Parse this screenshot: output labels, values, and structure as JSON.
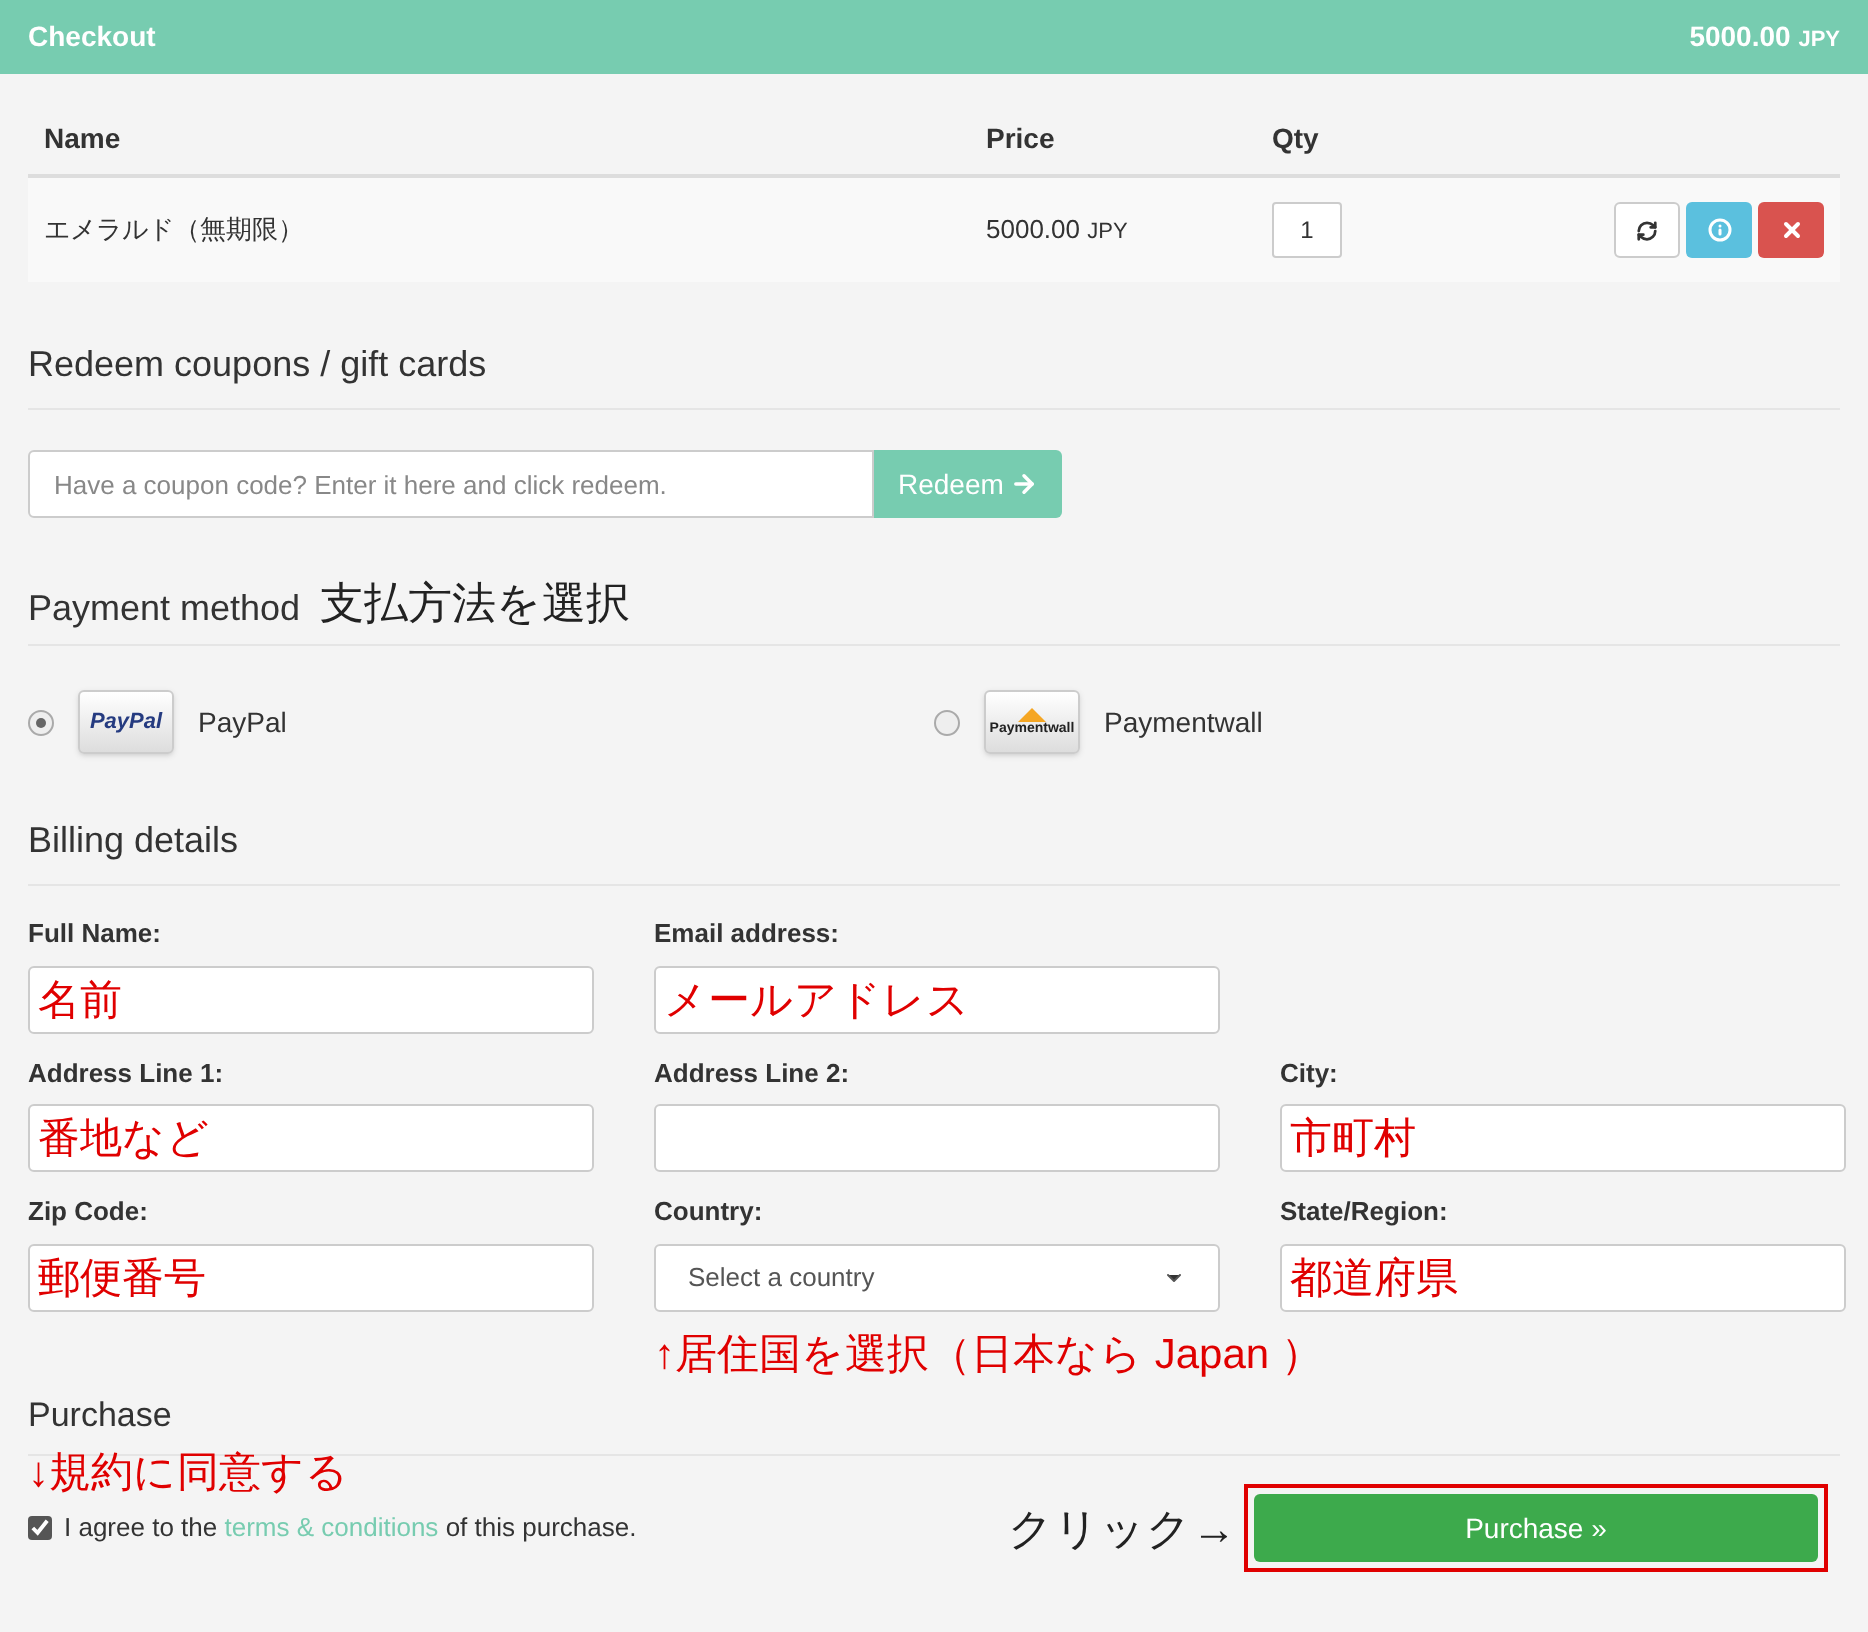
{
  "header": {
    "title": "Checkout",
    "total": "5000.00",
    "currency": "JPY"
  },
  "cart": {
    "columns": [
      "Name",
      "Price",
      "Qty"
    ],
    "rows": [
      {
        "name": "エメラルド（無期限）",
        "price": "5000.00",
        "currency": "JPY",
        "qty": "1"
      }
    ]
  },
  "coupon": {
    "heading": "Redeem coupons / gift cards",
    "placeholder": "Have a coupon code? Enter it here and click redeem.",
    "button": "Redeem"
  },
  "payment": {
    "heading": "Payment method",
    "note": "支払方法を選択",
    "methods": [
      {
        "kind": "paypal",
        "logo": "PayPal",
        "label": "PayPal",
        "selected": true
      },
      {
        "kind": "paymentwall",
        "logo": "Paymentwall",
        "label": "Paymentwall",
        "selected": false
      }
    ]
  },
  "billing": {
    "heading": "Billing details",
    "fields": [
      {
        "label": "Full Name:",
        "kind": "text",
        "value": "名前"
      },
      {
        "label": "Email address:",
        "kind": "text",
        "value": "メールアドレス"
      },
      {
        "kind": "gap"
      },
      {
        "label": "Address Line 1:",
        "kind": "text",
        "value": "番地など"
      },
      {
        "label": "Address Line 2:",
        "kind": "text"
      },
      {
        "label": "City:",
        "kind": "text",
        "value": "市町村"
      },
      {
        "label": "Zip Code:",
        "kind": "text",
        "value": "郵便番号"
      },
      {
        "label": "Country:",
        "kind": "select",
        "value": "Select a country"
      },
      {
        "label": "State/Region:",
        "kind": "text",
        "value": "都道府県"
      }
    ],
    "country_note": "↑居住国を選択（日本なら Japan ）"
  },
  "purchase": {
    "heading": "Purchase",
    "note": "↓規約に同意する",
    "agree": {
      "checked": true,
      "before": "I agree to the",
      "link": "terms & conditions",
      "after": "of this purchase."
    },
    "click_note": "クリック→",
    "button": "Purchase »",
    "highlighted": true
  }
}
